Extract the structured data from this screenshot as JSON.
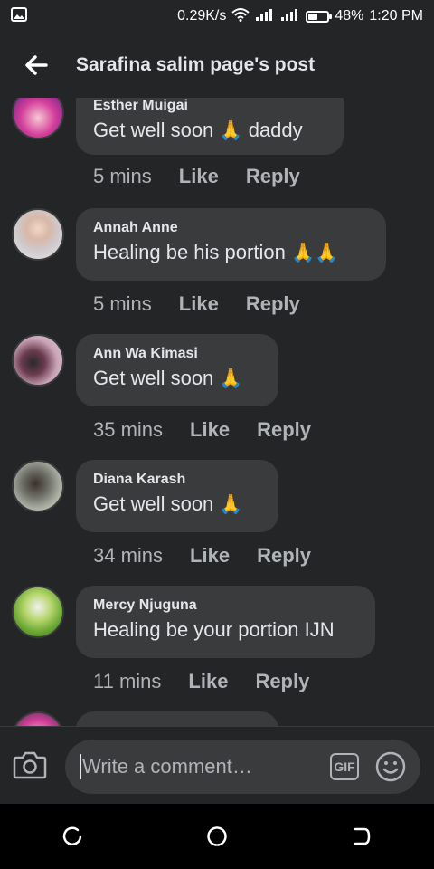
{
  "status_bar": {
    "speed": "0.29K/s",
    "battery_percent": "48%",
    "battery_level": 0.48,
    "time": "1:20 PM"
  },
  "header": {
    "title": "Sarafina salim page's post"
  },
  "comments": [
    {
      "author": "Esther Muigai",
      "text": "Get well soon",
      "emoji": "🙏",
      "text_after": "daddy",
      "time": "5 mins",
      "like": "Like",
      "reply": "Reply"
    },
    {
      "author": "Annah Anne",
      "text": "Healing be his portion",
      "emoji": "🙏🙏",
      "text_after": "",
      "time": "5 mins",
      "like": "Like",
      "reply": "Reply"
    },
    {
      "author": "Ann Wa Kimasi",
      "text": "Get well soon",
      "emoji": "🙏",
      "text_after": "",
      "time": "35 mins",
      "like": "Like",
      "reply": "Reply"
    },
    {
      "author": "Diana Karash",
      "text": "Get well soon",
      "emoji": "🙏",
      "text_after": "",
      "time": "34 mins",
      "like": "Like",
      "reply": "Reply"
    },
    {
      "author": "Mercy Njuguna",
      "text": "Healing be your portion IJN",
      "emoji": "",
      "text_after": "",
      "time": "11 mins",
      "like": "Like",
      "reply": "Reply"
    }
  ],
  "composer": {
    "placeholder": "Write a comment…",
    "gif_label": "GIF"
  },
  "icons": {
    "back": "arrow-left-icon",
    "camera": "camera-icon",
    "emoji": "smiley-icon",
    "recent": "recent-apps-icon",
    "home": "home-icon",
    "back_nav": "back-nav-icon"
  },
  "colors": {
    "background": "#242527",
    "bubble": "#3a3b3c",
    "text": "#e4e6eb",
    "muted": "#b0b3b8"
  }
}
